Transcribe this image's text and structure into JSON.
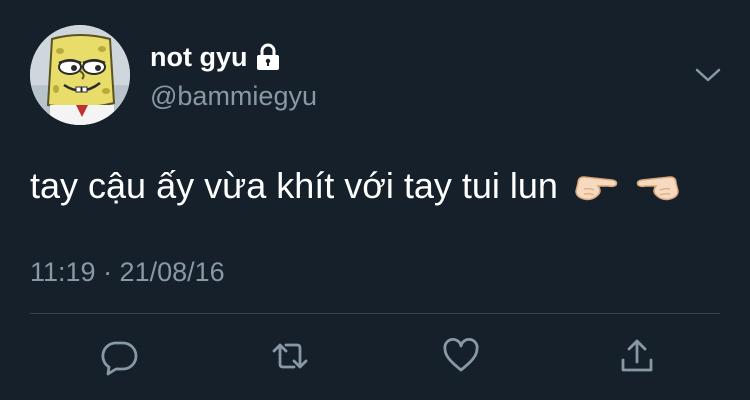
{
  "user": {
    "display_name": "not gyu",
    "handle": "@bammiegyu",
    "protected_icon": "lock-icon",
    "avatar": "spongebob-avatar"
  },
  "tweet": {
    "text": "tay cậu ấy vừa khít với tay tui lun",
    "emoji": [
      "pointing-right-hand-emoji",
      "pointing-left-hand-emoji"
    ],
    "timestamp": "11:19 · 21/08/16"
  },
  "actions": [
    {
      "name": "reply",
      "icon": "reply-icon"
    },
    {
      "name": "retweet",
      "icon": "retweet-icon"
    },
    {
      "name": "like",
      "icon": "heart-icon"
    },
    {
      "name": "share",
      "icon": "share-icon"
    }
  ],
  "colors": {
    "background": "#15202b",
    "text_primary": "#ffffff",
    "text_secondary": "#8899a6",
    "divider": "#38444d"
  }
}
